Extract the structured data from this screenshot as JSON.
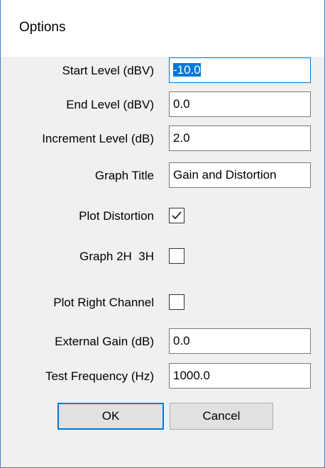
{
  "window": {
    "title": "Options"
  },
  "fields": {
    "start_level": {
      "label": "Start Level (dBV)",
      "value": "-10.0"
    },
    "end_level": {
      "label": "End Level (dBV)",
      "value": "0.0"
    },
    "increment_level": {
      "label": "Increment Level (dB)",
      "value": "2.0"
    },
    "graph_title": {
      "label": "Graph Title",
      "value": "Gain and Distortion"
    },
    "external_gain": {
      "label": "External Gain (dB)",
      "value": "0.0"
    },
    "test_frequency": {
      "label": "Test Frequency (Hz)",
      "value": "1000.0"
    }
  },
  "checkboxes": {
    "plot_distortion": {
      "label": "Plot Distortion",
      "checked": true
    },
    "graph_2h_3h": {
      "label": "Graph 2H  3H",
      "checked": false
    },
    "plot_right_channel": {
      "label": "Plot Right Channel",
      "checked": false
    }
  },
  "buttons": {
    "ok": "OK",
    "cancel": "Cancel"
  },
  "icons": {
    "checkmark": "check-icon"
  },
  "colors": {
    "accent": "#0078d7",
    "window_border": "#4a7cc0",
    "dialog_background": "#f0f0f0",
    "button_background": "#e1e1e1"
  }
}
